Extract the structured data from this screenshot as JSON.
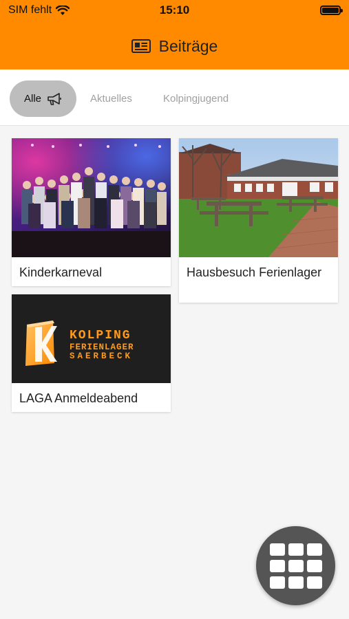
{
  "status_bar": {
    "carrier": "SIM fehlt",
    "time": "15:10"
  },
  "header": {
    "title": "Beiträge",
    "icon": "newspaper-icon",
    "background_color": "#ff8a00"
  },
  "tabs": [
    {
      "label": "Alle",
      "icon": "megaphone-icon",
      "active": true
    },
    {
      "label": "Aktuelles",
      "active": false
    },
    {
      "label": "Kolpingjugend",
      "active": false
    }
  ],
  "posts": [
    {
      "title": "Kinderkarneval",
      "image": "group-photo-on-stage"
    },
    {
      "title": "Hausbesuch Ferienlager",
      "image": "building-with-picnic-tables"
    },
    {
      "title": "LAGA Anmeldeabend",
      "image": "kolping-ferienlager-logo"
    }
  ],
  "logo_image": {
    "line1": "KOLPING",
    "line2": "FERIENLAGER",
    "line3": "SAERBECK"
  },
  "fab": {
    "icon": "grid-menu-icon"
  }
}
